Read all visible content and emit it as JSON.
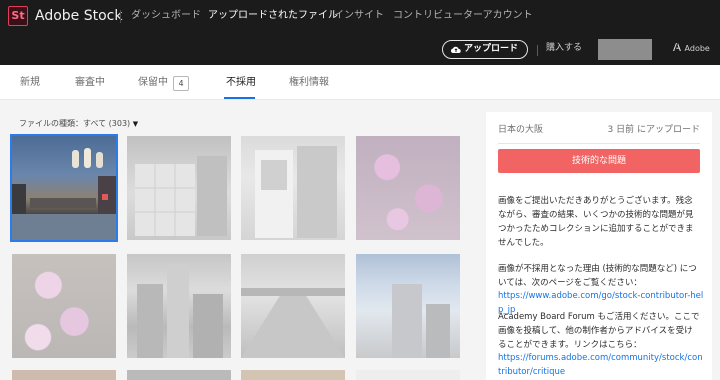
{
  "header": {
    "logo_text": "St",
    "brand": "Adobe Stock",
    "nav": [
      {
        "label": "ダッシュボード",
        "active": false
      },
      {
        "label": "アップロードされたファイル",
        "active": true
      },
      {
        "label": "インサイト",
        "active": false
      },
      {
        "label": "コントリビューターアカウント",
        "active": false
      }
    ],
    "upload_button": "アップロード",
    "purchase_link": "購入する",
    "adobe_label": "Adobe"
  },
  "tabs": [
    {
      "label": "新規"
    },
    {
      "label": "審査中"
    },
    {
      "label": "保留中",
      "count": "4"
    },
    {
      "label": "不採用",
      "active": true
    },
    {
      "label": "権利情報"
    }
  ],
  "filter": {
    "label": "ファイルの種類：すべて (303)"
  },
  "thumbnails": [
    {
      "icon": "dotonbori-canal-photo",
      "selected": true
    },
    {
      "icon": "lockers-photo"
    },
    {
      "icon": "ticket-machine-photo"
    },
    {
      "icon": "pink-flowers-photo"
    },
    {
      "icon": "cherry-blossom-photo"
    },
    {
      "icon": "city-buildings-photo"
    },
    {
      "icon": "bridge-walkway-photo"
    },
    {
      "icon": "skyscraper-blue-sky-photo"
    }
  ],
  "panel": {
    "title": "日本の大阪",
    "date": "3 日前 にアップロード",
    "status_button": "技術的な問題",
    "paragraph1": "画像をご提出いただきありがとうございます。残念ながら、審査の結果、いくつかの技術的な問題が見つかったためコレクションに追加することができませんでした。",
    "paragraph2": "画像が不採用となった理由 (技術的な問題など) については、次のページをご覧ください：",
    "link1": "https://www.adobe.com/go/stock-contributor-help_jp",
    "paragraph3": "Academy Board Forum もご活用ください。ここで画像を投稿して、他の制作者からアドバイスを受けることができます。リンクはこちら：",
    "link2": "https://forums.adobe.com/community/stock/contributor/critique"
  },
  "colors": {
    "header_bg": "#1b1b1b",
    "accent_blue": "#1473e6",
    "reject_red": "#f26464",
    "logo_pink": "#e03e57"
  }
}
